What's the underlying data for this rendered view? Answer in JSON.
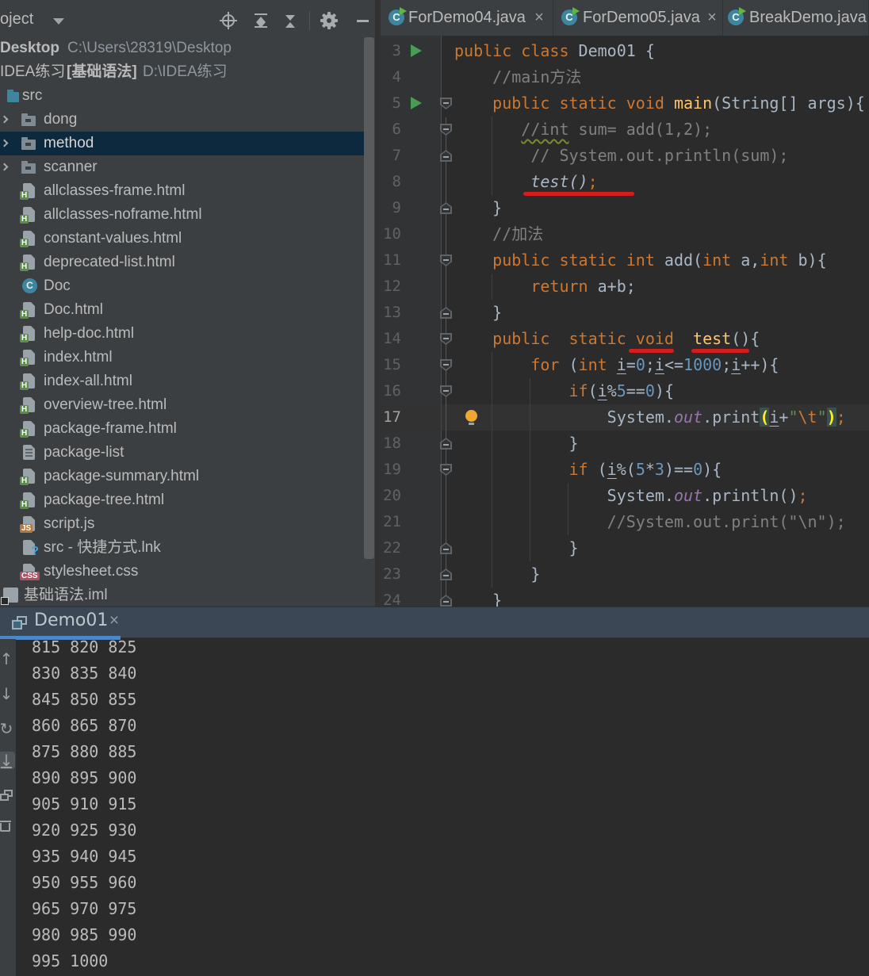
{
  "palette": {
    "panel_bg": "#3c3f41",
    "editor_bg": "#2b2b2b",
    "gutter_bg": "#313335",
    "selection_bg": "#0d293e",
    "caret_row": "#323232",
    "console_header_bg": "#3b4754",
    "tab_underline": "#4a88c7",
    "keyword": "#cc7832",
    "comment": "#808080",
    "number": "#6897bb",
    "string": "#6a8759",
    "method": "#ffc66d",
    "field": "#9876aa",
    "text": "#a9b7c6",
    "red_mark": "#d51d1d",
    "run_arrow": "#499c54",
    "bulb": "#f0a732"
  },
  "project_panel": {
    "title": "oject",
    "toolbar_icons": [
      "locate-icon",
      "expand-all-icon",
      "collapse-all-icon",
      "settings-icon",
      "hide-icon"
    ],
    "tree": [
      {
        "kind": "root",
        "label": "Desktop",
        "path": "C:\\Users\\28319\\Desktop"
      },
      {
        "kind": "root2",
        "label": "IDEA练习",
        "tag": "[基础语法]",
        "path": "D:\\IDEA练习"
      },
      {
        "kind": "src",
        "icon": "folder-blue",
        "label": "src"
      },
      {
        "kind": "dir",
        "icon": "folder",
        "label": "dong"
      },
      {
        "kind": "dir",
        "icon": "folder",
        "label": "method",
        "selected": true
      },
      {
        "kind": "dir",
        "icon": "folder",
        "label": "scanner"
      },
      {
        "kind": "file",
        "icon": "html",
        "label": "allclasses-frame.html"
      },
      {
        "kind": "file",
        "icon": "html",
        "label": "allclasses-noframe.html"
      },
      {
        "kind": "file",
        "icon": "html",
        "label": "constant-values.html"
      },
      {
        "kind": "file",
        "icon": "html",
        "label": "deprecated-list.html"
      },
      {
        "kind": "file",
        "icon": "class",
        "label": "Doc"
      },
      {
        "kind": "file",
        "icon": "html",
        "label": "Doc.html"
      },
      {
        "kind": "file",
        "icon": "html",
        "label": "help-doc.html"
      },
      {
        "kind": "file",
        "icon": "html",
        "label": "index.html"
      },
      {
        "kind": "file",
        "icon": "html",
        "label": "index-all.html"
      },
      {
        "kind": "file",
        "icon": "html",
        "label": "overview-tree.html"
      },
      {
        "kind": "file",
        "icon": "html",
        "label": "package-frame.html"
      },
      {
        "kind": "file",
        "icon": "text",
        "label": "package-list"
      },
      {
        "kind": "file",
        "icon": "html",
        "label": "package-summary.html"
      },
      {
        "kind": "file",
        "icon": "html",
        "label": "package-tree.html"
      },
      {
        "kind": "file",
        "icon": "js",
        "label": "script.js"
      },
      {
        "kind": "file",
        "icon": "lnk",
        "label": "src - 快捷方式.lnk"
      },
      {
        "kind": "file",
        "icon": "css",
        "label": "stylesheet.css"
      },
      {
        "kind": "iml",
        "icon": "iml",
        "label": "基础语法.iml"
      }
    ]
  },
  "editor": {
    "tabs": [
      {
        "label": "ForDemo04.java",
        "close": true
      },
      {
        "label": "ForDemo05.java",
        "close": true
      },
      {
        "label": "BreakDemo.java",
        "close": false
      }
    ],
    "first_line_number": 3,
    "run_lines": [
      3,
      5
    ],
    "fold_open": [
      5,
      6,
      11,
      14,
      15,
      16,
      19
    ],
    "fold_close": [
      7,
      9,
      13,
      18,
      22,
      23,
      24
    ],
    "bulb_line": 17,
    "caret_line": 17,
    "code": [
      {
        "n": 3,
        "tokens": [
          [
            "k",
            "public class"
          ],
          [
            "p",
            " Demo01 {"
          ]
        ]
      },
      {
        "n": 4,
        "tokens": [
          [
            "c",
            "    //main方法"
          ]
        ]
      },
      {
        "n": 5,
        "tokens": [
          [
            "k",
            "    public static void "
          ],
          [
            "m",
            "main"
          ],
          [
            "p",
            "(String[] args){"
          ]
        ]
      },
      {
        "n": 6,
        "tokens": [
          [
            "p",
            "       "
          ],
          [
            "w",
            "//int"
          ],
          [
            "c",
            " sum= add(1,2);"
          ]
        ]
      },
      {
        "n": 7,
        "tokens": [
          [
            "c",
            "        // System.out.println(sum);"
          ]
        ]
      },
      {
        "n": 8,
        "tokens": [
          [
            "p",
            "        "
          ],
          [
            "i",
            "test()"
          ],
          [
            "k",
            ";"
          ]
        ]
      },
      {
        "n": 9,
        "tokens": [
          [
            "p",
            "    }"
          ]
        ]
      },
      {
        "n": 10,
        "tokens": [
          [
            "c",
            "    //加法"
          ]
        ]
      },
      {
        "n": 11,
        "tokens": [
          [
            "k",
            "    public static int "
          ],
          [
            "p",
            "add("
          ],
          [
            "k",
            "int"
          ],
          [
            "p",
            " a,"
          ],
          [
            "k",
            "int"
          ],
          [
            "p",
            " b){"
          ]
        ]
      },
      {
        "n": 12,
        "tokens": [
          [
            "k",
            "        return"
          ],
          [
            "p",
            " a+b;"
          ]
        ]
      },
      {
        "n": 13,
        "tokens": [
          [
            "p",
            "    }"
          ]
        ]
      },
      {
        "n": 14,
        "tokens": [
          [
            "k",
            "    public  static void  "
          ],
          [
            "m",
            "test"
          ],
          [
            "p",
            "(){"
          ]
        ]
      },
      {
        "n": 15,
        "tokens": [
          [
            "k",
            "        for"
          ],
          [
            "p",
            " ("
          ],
          [
            "k",
            "int"
          ],
          [
            "p",
            " "
          ],
          [
            "v",
            "i"
          ],
          [
            "p",
            "="
          ],
          [
            "n",
            "0"
          ],
          [
            "p",
            ";"
          ],
          [
            "v",
            "i"
          ],
          [
            "p",
            "<="
          ],
          [
            "n",
            "1000"
          ],
          [
            "p",
            ";"
          ],
          [
            "v",
            "i"
          ],
          [
            "p",
            "++){"
          ]
        ]
      },
      {
        "n": 16,
        "tokens": [
          [
            "k",
            "            if"
          ],
          [
            "p",
            "("
          ],
          [
            "v",
            "i"
          ],
          [
            "p",
            "%"
          ],
          [
            "n",
            "5"
          ],
          [
            "p",
            "=="
          ],
          [
            "n",
            "0"
          ],
          [
            "p",
            "){"
          ]
        ]
      },
      {
        "n": 17,
        "tokens": [
          [
            "p",
            "                System."
          ],
          [
            "f",
            "out"
          ],
          [
            "p",
            ".print"
          ],
          [
            "b",
            "("
          ],
          [
            "v",
            "i"
          ],
          [
            "p",
            "+"
          ],
          [
            "s",
            "\""
          ],
          [
            "e",
            "\\t"
          ],
          [
            "s",
            "\""
          ],
          [
            "b",
            ")"
          ],
          [
            "k",
            ";"
          ]
        ]
      },
      {
        "n": 18,
        "tokens": [
          [
            "p",
            "            }"
          ]
        ]
      },
      {
        "n": 19,
        "tokens": [
          [
            "k",
            "            if"
          ],
          [
            "p",
            " ("
          ],
          [
            "v",
            "i"
          ],
          [
            "p",
            "%("
          ],
          [
            "n",
            "5"
          ],
          [
            "p",
            "*"
          ],
          [
            "n",
            "3"
          ],
          [
            "p",
            ")=="
          ],
          [
            "n",
            "0"
          ],
          [
            "p",
            "){"
          ]
        ]
      },
      {
        "n": 20,
        "tokens": [
          [
            "p",
            "                System."
          ],
          [
            "f",
            "out"
          ],
          [
            "p",
            ".println()"
          ],
          [
            "k",
            ";"
          ]
        ]
      },
      {
        "n": 21,
        "tokens": [
          [
            "c",
            "                //System.out.print(\"\\n\");"
          ]
        ]
      },
      {
        "n": 22,
        "tokens": [
          [
            "p",
            "            }"
          ]
        ]
      },
      {
        "n": 23,
        "tokens": [
          [
            "p",
            "        }"
          ]
        ]
      },
      {
        "n": 24,
        "tokens": [
          [
            "p",
            "    }"
          ]
        ]
      }
    ],
    "red_marks": [
      {
        "line": 8,
        "under": "test();"
      },
      {
        "line": 14,
        "under": "void"
      },
      {
        "line": 14,
        "under": "test()"
      }
    ]
  },
  "console": {
    "tab_label": "Demo01",
    "toolbar_icons": [
      "scroll-up-icon",
      "scroll-down-icon",
      "rerun-icon",
      "scroll-to-end-icon",
      "print-icon",
      "clear-icon"
    ],
    "lines": [
      "815 820 825",
      "830 835 840",
      "845 850 855",
      "860 865 870",
      "875 880 885",
      "890 895 900",
      "905 910 915",
      "920 925 930",
      "935 940 945",
      "950 955 960",
      "965 970 975",
      "980 985 990",
      "995 1000"
    ]
  }
}
